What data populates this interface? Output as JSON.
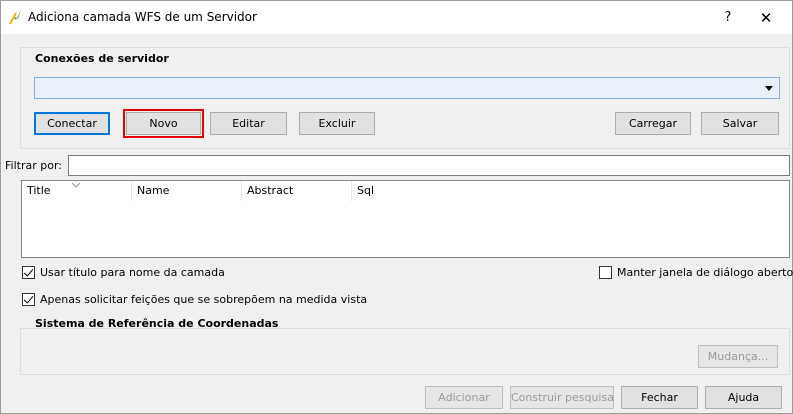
{
  "window": {
    "title": "Adiciona camada WFS de um Servidor",
    "help": "?",
    "close": "✕"
  },
  "connections": {
    "title": "Conexões de servidor",
    "selected": "",
    "buttons": {
      "connect": "Conectar",
      "new": "Novo",
      "edit": "Editar",
      "delete": "Excluir",
      "load": "Carregar",
      "save": "Salvar"
    }
  },
  "filter": {
    "label": "Filtrar por:",
    "value": ""
  },
  "table": {
    "columns": [
      "Title",
      "Name",
      "Abstract",
      "Sql"
    ],
    "rows": []
  },
  "options": {
    "use_title": {
      "label": "Usar título para nome da camada",
      "checked": true
    },
    "keep_open": {
      "label": "Manter janela de diálogo aberto",
      "checked": false
    },
    "only_overlap": {
      "label": "Apenas solicitar feições que se sobrepõem na medida vista",
      "checked": true
    }
  },
  "crs": {
    "title": "Sistema de Referência de Coordenadas",
    "change": "Mudança..."
  },
  "footer": {
    "add": "Adicionar",
    "build_query": "Construir pesquisa",
    "close": "Fechar",
    "help": "Ajuda"
  },
  "colors": {
    "highlight": "#e00000",
    "accent": "#0078d7"
  }
}
